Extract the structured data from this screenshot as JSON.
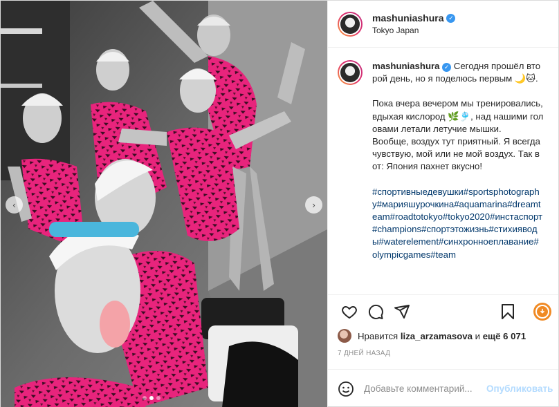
{
  "header": {
    "username": "mashuniashura",
    "location": "Tokyo Japan",
    "verified_icon": "verified-badge-icon"
  },
  "caption": {
    "username": "mashuniashura",
    "line1": "Сегодня прошёл второй день, но я поделюсь первым 🌙🐱.",
    "line2": "Пока вчера вечером мы тренировались, вдыхая кислород 🌿🎐, над нашими головами летали летучие мышки.",
    "line3": "Вообще, воздух тут приятный. Я всегда чувствую, мой или не мой воздух. Так вот: Япония пахнет вкусно!",
    "hashtags": [
      "#спортивныедевушки",
      "#sportsphotography",
      "#марияшурочкина",
      "#aquamarina",
      "#dreamteam",
      "#roadtotokyo",
      "#tokyo2020",
      "#инстаспорт",
      "#champions",
      "#спортэтожизнь",
      "#стихияводы",
      "#waterelement",
      "#синхронноеплавание",
      "#olympicgames",
      "#team"
    ]
  },
  "actions": {
    "like_icon": "heart-icon",
    "comment_icon": "comment-icon",
    "share_icon": "share-icon",
    "save_icon": "bookmark-icon",
    "download_icon": "download-icon",
    "download_color": "#f08a24"
  },
  "likes": {
    "prefix": "Нравится",
    "user": "liza_arzamasova",
    "middle": "и",
    "count": "ещё 6 071"
  },
  "timestamp": "7 ДНЕЙ НАЗАД",
  "comment_box": {
    "placeholder": "Добавьте комментарий...",
    "publish_label": "Опубликовать",
    "publish_color": "#b3dbff"
  },
  "carousel": {
    "left_arrow": "‹",
    "right_arrow": "›",
    "slides_total": 3,
    "active_slide": 2
  },
  "colors": {
    "swimsuit": "#e8247c",
    "hashtag": "#00376b",
    "verified": "#3897f0"
  }
}
